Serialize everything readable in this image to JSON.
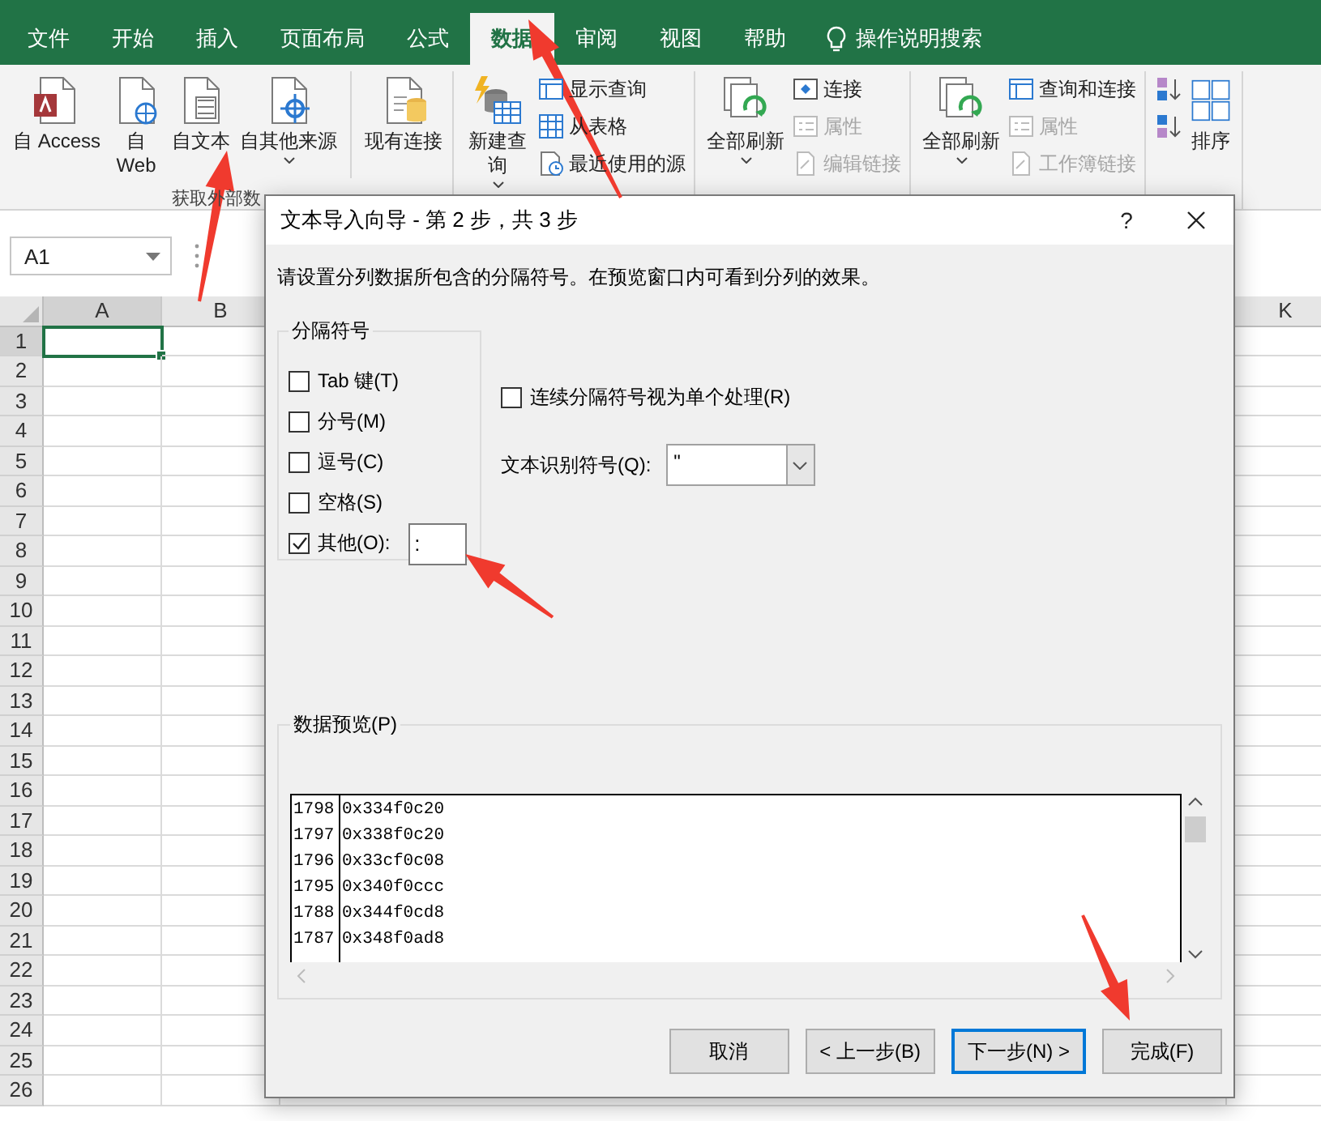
{
  "tabs": [
    {
      "label": "文件",
      "selected": false
    },
    {
      "label": "开始",
      "selected": false
    },
    {
      "label": "插入",
      "selected": false
    },
    {
      "label": "页面布局",
      "selected": false
    },
    {
      "label": "公式",
      "selected": false
    },
    {
      "label": "数据",
      "selected": true
    },
    {
      "label": "审阅",
      "selected": false
    },
    {
      "label": "视图",
      "selected": false
    },
    {
      "label": "帮助",
      "selected": false
    }
  ],
  "tell_me": "操作说明搜索",
  "ribbon": [
    {
      "kind": "normal",
      "label": "获取外部数",
      "large": [
        {
          "kind": "access",
          "label": "自 Access"
        },
        {
          "kind": "web",
          "label": "自 Web"
        },
        {
          "kind": "text",
          "label": "自文本"
        },
        {
          "kind": "other",
          "label": "自其他来源",
          "dropdown": true
        },
        {
          "kind": "existing",
          "label": "现有连接",
          "separator_before": true
        }
      ]
    },
    {
      "kind": "normal",
      "large": [
        {
          "kind": "newquery",
          "label": "新建查询",
          "dropdown": true
        }
      ],
      "small": [
        {
          "kind": "show",
          "label": "显示查询",
          "disabled": false
        },
        {
          "kind": "table",
          "label": "从表格",
          "disabled": false
        },
        {
          "kind": "recent",
          "label": "最近使用的源",
          "disabled": false
        }
      ]
    },
    {
      "kind": "normal",
      "large": [
        {
          "kind": "refresh",
          "label": "全部刷新",
          "dropdown": true
        }
      ],
      "small": [
        {
          "kind": "link",
          "label": "连接",
          "disabled": false
        },
        {
          "kind": "props",
          "label": "属性",
          "disabled": true
        },
        {
          "kind": "editlinks",
          "label": "编辑链接",
          "disabled": true
        }
      ]
    },
    {
      "kind": "normal",
      "large": [
        {
          "kind": "refresh",
          "label": "全部刷新",
          "dropdown": true
        }
      ],
      "small": [
        {
          "kind": "queries",
          "label": "查询和连接",
          "disabled": false
        },
        {
          "kind": "props",
          "label": "属性",
          "disabled": true
        },
        {
          "kind": "editlinks",
          "label": "工作簿链接",
          "disabled": true
        }
      ]
    },
    {
      "kind": "sort",
      "large": [
        {
          "kind": "sort",
          "label": "排序"
        }
      ],
      "small": [
        {
          "kind": "sort-asc"
        },
        {
          "kind": "sort-desc"
        }
      ]
    }
  ],
  "name_box": "A1",
  "columns": [
    {
      "label": "A",
      "active": true
    },
    {
      "label": "B",
      "active": false
    },
    {
      "label": "K",
      "active": false
    }
  ],
  "rows": [
    {
      "label": "1",
      "active": true
    },
    {
      "label": "2",
      "active": false
    },
    {
      "label": "3",
      "active": false
    },
    {
      "label": "4",
      "active": false
    },
    {
      "label": "5",
      "active": false
    },
    {
      "label": "6",
      "active": false
    },
    {
      "label": "7",
      "active": false
    },
    {
      "label": "8",
      "active": false
    },
    {
      "label": "9",
      "active": false
    },
    {
      "label": "10",
      "active": false
    },
    {
      "label": "11",
      "active": false
    },
    {
      "label": "12",
      "active": false
    },
    {
      "label": "13",
      "active": false
    },
    {
      "label": "14",
      "active": false
    },
    {
      "label": "15",
      "active": false
    },
    {
      "label": "16",
      "active": false
    },
    {
      "label": "17",
      "active": false
    },
    {
      "label": "18",
      "active": false
    },
    {
      "label": "19",
      "active": false
    },
    {
      "label": "20",
      "active": false
    },
    {
      "label": "21",
      "active": false
    },
    {
      "label": "22",
      "active": false
    },
    {
      "label": "23",
      "active": false
    },
    {
      "label": "24",
      "active": false
    },
    {
      "label": "25",
      "active": false
    },
    {
      "label": "26",
      "active": false
    }
  ],
  "dialog": {
    "title": "文本导入向导 - 第 2 步，共 3 步",
    "help": "?",
    "instruction": "请设置分列数据所包含的分隔符号。在预览窗口内可看到分列的效果。",
    "delimiters": {
      "legend": "分隔符号",
      "options": [
        {
          "kind": "plain",
          "label": "Tab 键(T)",
          "checked": false
        },
        {
          "kind": "plain",
          "label": "分号(M)",
          "checked": false
        },
        {
          "kind": "plain",
          "label": "逗号(C)",
          "checked": false
        },
        {
          "kind": "plain",
          "label": "空格(S)",
          "checked": false
        },
        {
          "kind": "other",
          "label": "其他(O):",
          "checked": true,
          "value": ":"
        }
      ]
    },
    "consecutive": {
      "label": "连续分隔符号视为单个处理(R)",
      "checked": false
    },
    "qualifier": {
      "label": "文本识别符号(Q):",
      "value": "\""
    },
    "preview": {
      "legend": "数据预览(P)",
      "rows": [
        [
          "1798",
          "0x334f0c20"
        ],
        [
          "1797",
          "0x338f0c20"
        ],
        [
          "1796",
          "0x33cf0c08"
        ],
        [
          "1795",
          "0x340f0ccc"
        ],
        [
          "1788",
          "0x344f0cd8"
        ],
        [
          "1787",
          "0x348f0ad8"
        ]
      ]
    },
    "buttons": [
      {
        "label": "取消",
        "default": false
      },
      {
        "label": "< 上一步(B)",
        "default": false
      },
      {
        "label": "下一步(N) >",
        "default": true
      },
      {
        "label": "完成(F)",
        "default": false
      }
    ]
  }
}
